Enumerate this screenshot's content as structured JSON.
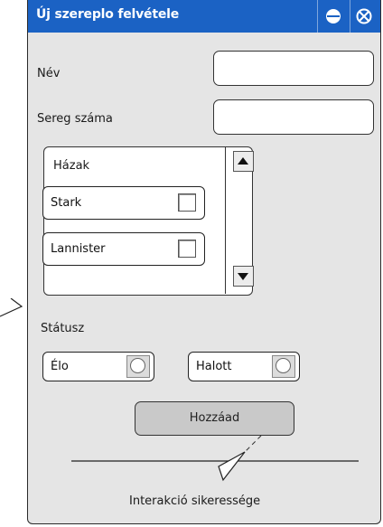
{
  "window": {
    "title": "Új szereplo felvétele",
    "colors": {
      "titlebar": "#1b62c4",
      "body": "#e5e5e5",
      "button": "#c9c9c9"
    },
    "icons": [
      "minimize-icon",
      "close-icon"
    ]
  },
  "form": {
    "name_label": "Név",
    "name_value": "",
    "army_label": "Sereg száma",
    "army_value": ""
  },
  "houses": {
    "header": "Házak",
    "items": [
      {
        "label": "Stark",
        "checked": false
      },
      {
        "label": "Lannister",
        "checked": false
      }
    ]
  },
  "status": {
    "label": "Státusz",
    "options": [
      {
        "label": "Élo",
        "selected": false
      },
      {
        "label": "Halott",
        "selected": false
      }
    ]
  },
  "actions": {
    "add_label": "Hozzáad"
  },
  "annotation": {
    "interaction_label": "Interakció sikeressége"
  }
}
